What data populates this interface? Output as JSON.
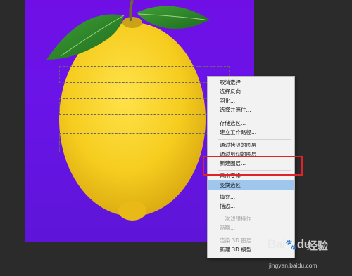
{
  "canvas": {
    "background_color": "#6a14e8",
    "lemon_color": "#f4cc1f",
    "leaf_color": "#2e8b2a"
  },
  "context_menu": {
    "items": [
      {
        "label": "取消选择",
        "enabled": true
      },
      {
        "label": "选择反向",
        "enabled": true
      },
      {
        "label": "羽化...",
        "enabled": true
      },
      {
        "label": "选择并遮住...",
        "enabled": true
      },
      {
        "label": "存储选区...",
        "enabled": true
      },
      {
        "label": "建立工作路径...",
        "enabled": true
      },
      {
        "label": "通过拷贝的图层",
        "enabled": true
      },
      {
        "label": "通过剪切的图层",
        "enabled": true
      },
      {
        "label": "新建图层...",
        "enabled": true
      },
      {
        "label": "自由变换",
        "enabled": true
      },
      {
        "label": "变换选区",
        "enabled": true,
        "highlighted": true
      },
      {
        "label": "填充...",
        "enabled": true
      },
      {
        "label": "描边...",
        "enabled": true
      },
      {
        "label": "上次滤镜操作",
        "enabled": false
      },
      {
        "label": "渐隐...",
        "enabled": false
      },
      {
        "label": "渲染 3D 图层",
        "enabled": false
      },
      {
        "label": "新建 3D 模型",
        "enabled": true
      }
    ],
    "highlight_color": "#e0222a"
  },
  "watermark": {
    "logo": "Bai",
    "logo_tail": "du",
    "brand_cn": "经验",
    "url": "jingyan.baidu.com"
  }
}
